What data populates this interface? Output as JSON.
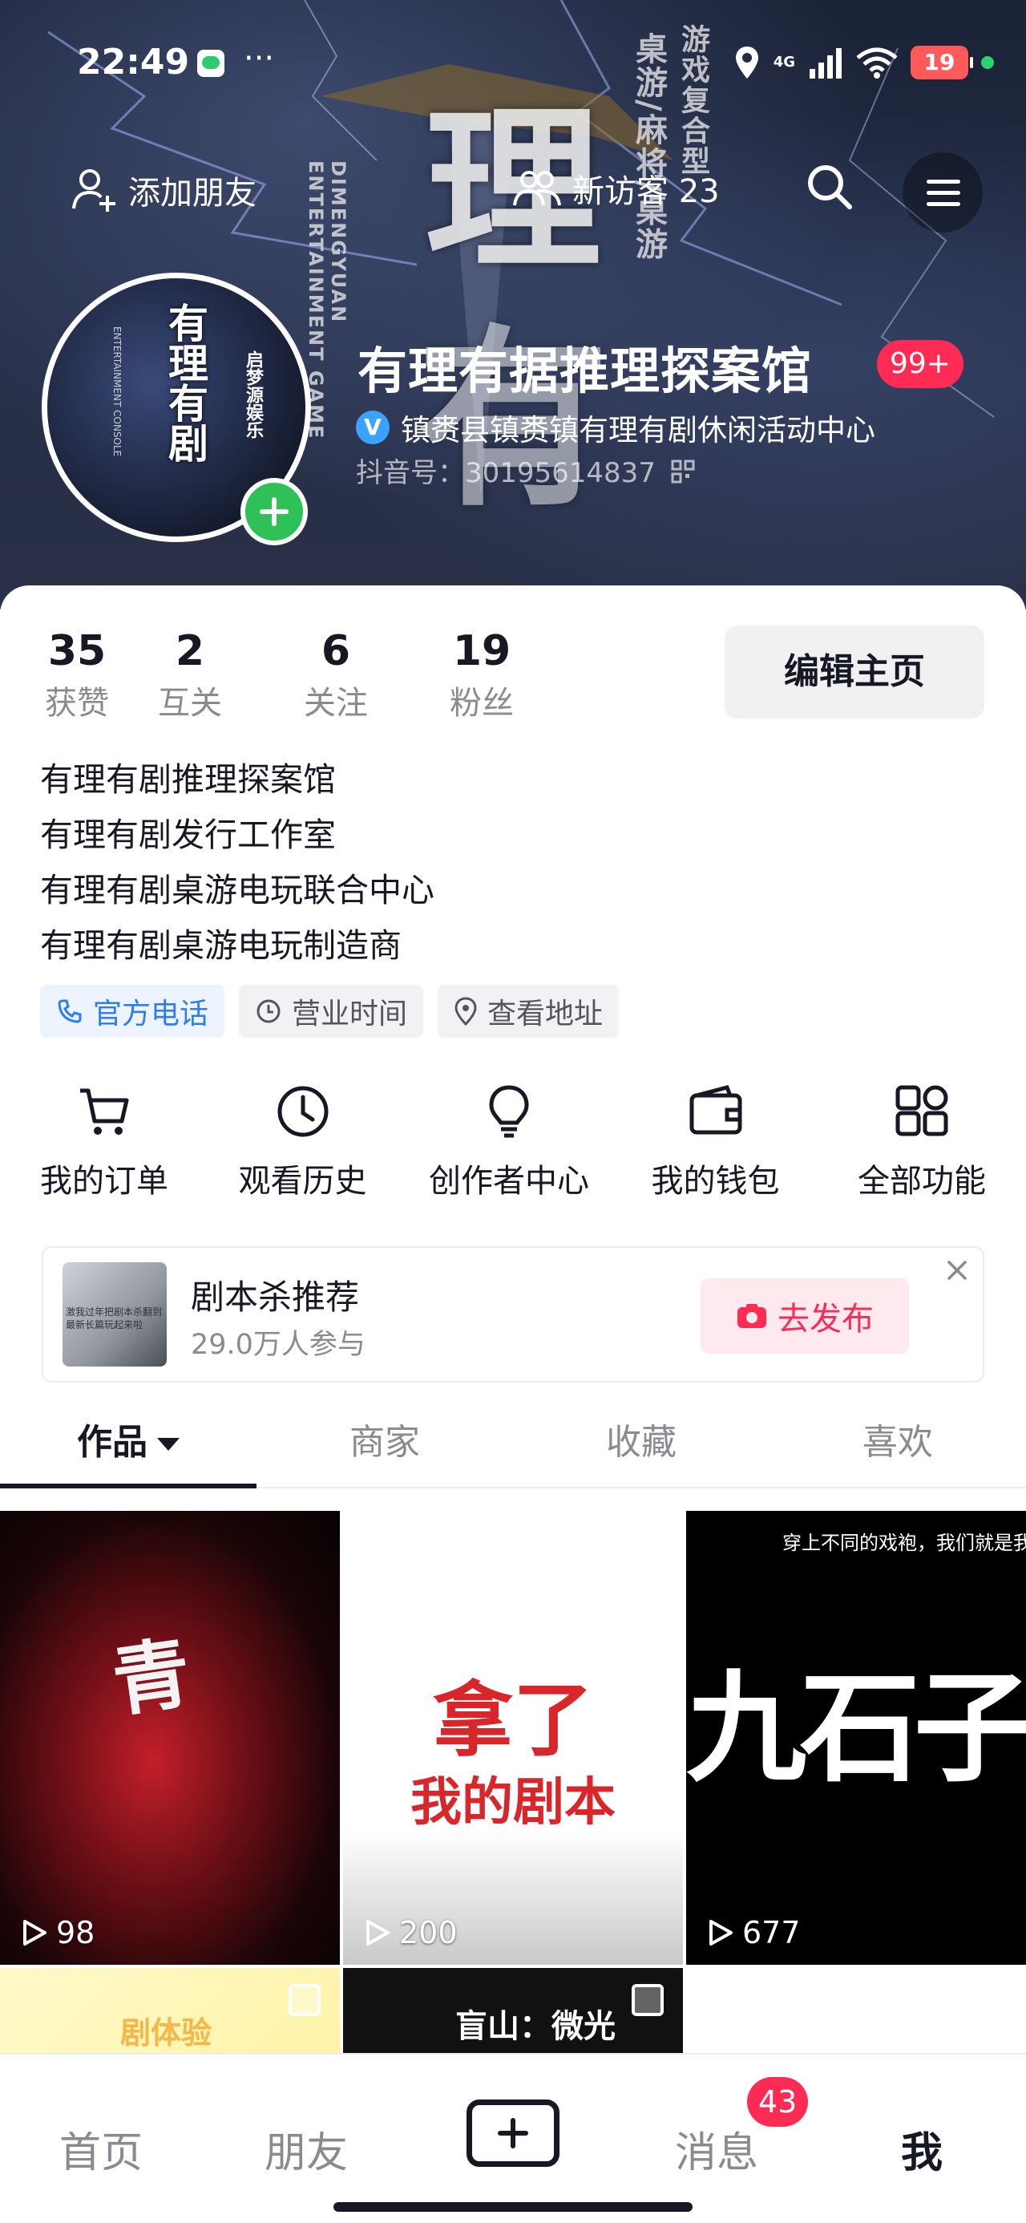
{
  "status_bar": {
    "time": "22:49",
    "dots": "···",
    "network": "4G",
    "battery": "19"
  },
  "header": {
    "add_friend": "添加朋友",
    "new_visitors": "新访客 23"
  },
  "banner_art": {
    "big_chars": [
      "理",
      "有"
    ],
    "vertical_left": "DIMENGYUAN ENTERTAINMENT GAME",
    "vertical_mid": "桌游/麻将/桌游",
    "vertical_right": "游戏复合型"
  },
  "profile": {
    "nickname": "有理有据推理探案馆",
    "nickname_badge": "99+",
    "verify_text": "镇赉县镇赉镇有理有剧休闲活动中心",
    "douyin_id": "抖音号：30195614837",
    "avatar_text": "有理有剧",
    "avatar_side": "启梦源娱乐",
    "avatar_tiny": "ENTERTAINMENT CONSOLE"
  },
  "stats": [
    {
      "value": "35",
      "label": "获赞"
    },
    {
      "value": "2",
      "label": "互关"
    },
    {
      "value": "6",
      "label": "关注"
    },
    {
      "value": "19",
      "label": "粉丝"
    }
  ],
  "edit_button": "编辑主页",
  "bio": [
    "有理有剧推理探案馆",
    "有理有剧发行工作室",
    "有理有剧桌游电玩联合中心",
    "有理有剧桌游电玩制造商"
  ],
  "chips": {
    "phone": "官方电话",
    "hours": "营业时间",
    "address": "查看地址"
  },
  "shortcuts": [
    {
      "label": "我的订单",
      "icon": "cart-icon"
    },
    {
      "label": "观看历史",
      "icon": "clock-icon"
    },
    {
      "label": "创作者中心",
      "icon": "bulb-icon"
    },
    {
      "label": "我的钱包",
      "icon": "wallet-icon"
    },
    {
      "label": "全部功能",
      "icon": "grid-icon"
    }
  ],
  "promo": {
    "title": "剧本杀推荐",
    "subtitle": "29.0万人参与",
    "button": "去发布",
    "thumb_text": "激我过年把剧本杀翻到最新长篇玩起来啦"
  },
  "tabs": [
    "作品",
    "商家",
    "收藏",
    "喜欢"
  ],
  "videos": [
    {
      "views": "98",
      "art": "青"
    },
    {
      "views": "200",
      "art1": "拿了",
      "art2": "我的剧本"
    },
    {
      "views": "677",
      "top": "穿上不同的戏袍，我们就是我",
      "art": "九石子"
    }
  ],
  "videos_row2": {
    "t4": "剧体验",
    "t5": "盲山：微光"
  },
  "bottom_nav": {
    "home": "首页",
    "friends": "朋友",
    "messages": "消息",
    "messages_badge": "43",
    "me": "我"
  },
  "colors": {
    "accent": "#fe2c55",
    "link_blue": "#2c7df7",
    "verify_blue": "#3aa3ff",
    "plus_green": "#2dc158"
  }
}
